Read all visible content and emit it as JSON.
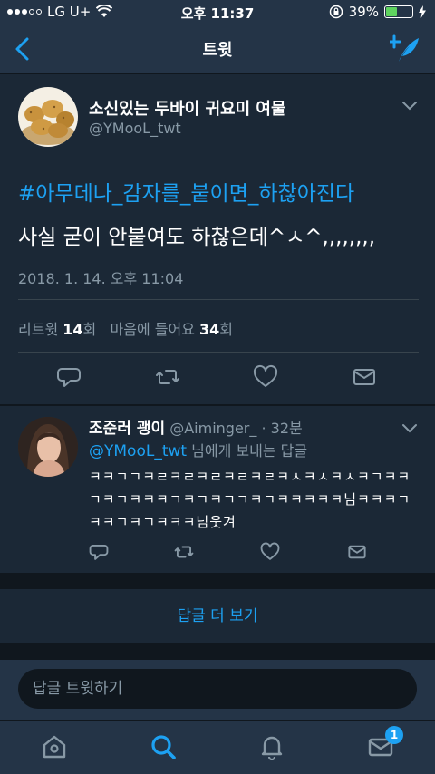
{
  "status_bar": {
    "carrier": "LG U+",
    "time": "오후 11:37",
    "battery": "39%",
    "battery_level": 0.39
  },
  "nav": {
    "title": "트윗"
  },
  "tweet": {
    "author_name": "소신있는 두바이 귀요미 여물",
    "author_handle": "@YMooL_twt",
    "hashtag": "#아무데나_감자를_붙이면_하찮아진다",
    "text": "사실 굳이 안붙여도 하찮은데^ㅅ^,,,,,,,,",
    "timestamp": "2018. 1. 14. 오후 11:04",
    "retweet_label": "리트윗",
    "retweet_count": "14",
    "retweet_unit": "회",
    "like_label": "마음에 들어요",
    "like_count": "34",
    "like_unit": "회"
  },
  "reply": {
    "name": "조준러 괭이",
    "handle": "@Aiminger_",
    "separator": "·",
    "age": "32분",
    "reply_to_mention": "@YMooL_twt",
    "reply_to_suffix": " 님에게 보내는 답글",
    "text": "ㅋㅋㄱㄱㅋㄹㅋㄹㅋㄹㅋㄹㅋㄹㅋㅅㅋㅅㅋㅅㅋㄱㅋㅋㄱㅋㄱㅋㅋㅋㄱㅋㄱㅋㄱㄱㅋㄱㅋㅋㅋㅋㅋ님ㅋㅋㅋㄱㅋㅋㄱㅋㄱㅋㅋㅋ넘웃겨"
  },
  "more_replies": "답글 더 보기",
  "reply_input": {
    "placeholder": "답글 트윗하기"
  },
  "tab_bar": {
    "messages_badge": "1"
  },
  "colors": {
    "accent": "#1da1f2",
    "background": "#141d26",
    "card": "#1b2836",
    "bar": "#243447",
    "secondary_text": "#8899a6"
  },
  "icons": [
    "back-arrow-icon",
    "compose-feather-icon",
    "chevron-down-icon",
    "reply-icon",
    "retweet-icon",
    "heart-icon",
    "mail-icon",
    "home-icon",
    "search-icon",
    "bell-icon",
    "messages-icon"
  ]
}
